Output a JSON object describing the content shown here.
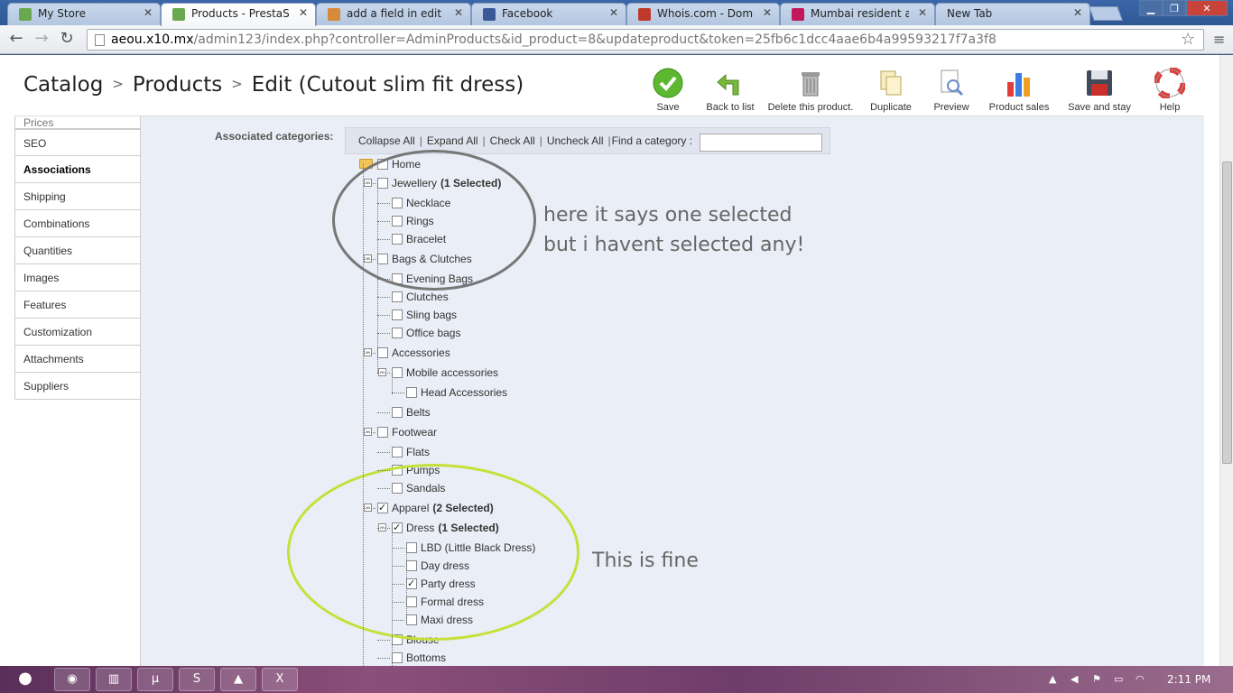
{
  "browser": {
    "tabs": [
      {
        "title": "My Store",
        "active": false
      },
      {
        "title": "Products - PrestaShop",
        "active": true
      },
      {
        "title": "add a field in edit proc",
        "active": false
      },
      {
        "title": "Facebook",
        "active": false
      },
      {
        "title": "Whois.com - Domain",
        "active": false
      },
      {
        "title": "Mumbai resident arres",
        "active": false
      },
      {
        "title": "New Tab",
        "active": false
      }
    ],
    "url_host": "aeou.x10.mx",
    "url_path": "/admin123/index.php?controller=AdminProducts&id_product=8&updateproduct&token=25fb6c1dcc4aae6b4a99593217f7a3f8"
  },
  "header": {
    "breadcrumb": [
      "Catalog",
      "Products",
      "Edit (Cutout slim fit dress)"
    ],
    "toolbar": [
      {
        "label": "Save",
        "icon": "check-icon"
      },
      {
        "label": "Back to list",
        "icon": "back-arrow-icon"
      },
      {
        "label": "Delete this product.",
        "icon": "trash-icon"
      },
      {
        "label": "Duplicate",
        "icon": "duplicate-icon"
      },
      {
        "label": "Preview",
        "icon": "preview-icon"
      },
      {
        "label": "Product sales",
        "icon": "bar-chart-icon"
      },
      {
        "label": "Save and stay",
        "icon": "floppy-icon"
      },
      {
        "label": "Help",
        "icon": "lifebuoy-icon"
      }
    ]
  },
  "sidebar": {
    "items": [
      "Prices",
      "SEO",
      "Associations",
      "Shipping",
      "Combinations",
      "Quantities",
      "Images",
      "Features",
      "Customization",
      "Attachments",
      "Suppliers"
    ],
    "active": "Associations"
  },
  "associations": {
    "label": "Associated categories:",
    "tree_actions": [
      "Collapse All",
      "Expand All",
      "Check All",
      "Uncheck All"
    ],
    "find_label": "Find a category :",
    "tree": [
      {
        "label": "Home",
        "level": 0,
        "checked": false
      },
      {
        "label": "Jewellery",
        "badge": "(1 Selected)",
        "level": 1,
        "checked": false
      },
      {
        "label": "Necklace",
        "level": 2,
        "checked": false
      },
      {
        "label": "Rings",
        "level": 2,
        "checked": false
      },
      {
        "label": "Bracelet",
        "level": 2,
        "checked": false
      },
      {
        "label": "Bags & Clutches",
        "level": 1,
        "checked": false
      },
      {
        "label": "Evening Bags",
        "level": 2,
        "checked": false
      },
      {
        "label": "Clutches",
        "level": 2,
        "checked": false
      },
      {
        "label": "Sling bags",
        "level": 2,
        "checked": false
      },
      {
        "label": "Office bags",
        "level": 2,
        "checked": false
      },
      {
        "label": "Accessories",
        "level": 1,
        "checked": false
      },
      {
        "label": "Mobile accessories",
        "level": 2,
        "checked": false
      },
      {
        "label": "Head Accessories",
        "level": 3,
        "checked": false
      },
      {
        "label": "Belts",
        "level": 2,
        "checked": false
      },
      {
        "label": "Footwear",
        "level": 1,
        "checked": false
      },
      {
        "label": "Flats",
        "level": 2,
        "checked": false
      },
      {
        "label": "Pumps",
        "level": 2,
        "checked": false
      },
      {
        "label": "Sandals",
        "level": 2,
        "checked": false
      },
      {
        "label": "Apparel",
        "badge": "(2 Selected)",
        "level": 1,
        "checked": true
      },
      {
        "label": "Dress",
        "badge": "(1 Selected)",
        "level": 2,
        "checked": true
      },
      {
        "label": "LBD (Little Black Dress)",
        "level": 3,
        "checked": false
      },
      {
        "label": "Day dress",
        "level": 3,
        "checked": false
      },
      {
        "label": "Party dress",
        "level": 3,
        "checked": true
      },
      {
        "label": "Formal dress",
        "level": 3,
        "checked": false
      },
      {
        "label": "Maxi dress",
        "level": 3,
        "checked": false
      },
      {
        "label": "Blouse",
        "level": 2,
        "checked": false
      },
      {
        "label": "Bottoms",
        "level": 2,
        "checked": false
      }
    ]
  },
  "annotations": {
    "note1_line1": "here it says one selected",
    "note1_line2": "but i havent selected any!",
    "note2": "This is fine",
    "gray_color": "#777777",
    "green_color": "#c6e03a"
  },
  "taskbar": {
    "clock": "2:11 PM"
  }
}
